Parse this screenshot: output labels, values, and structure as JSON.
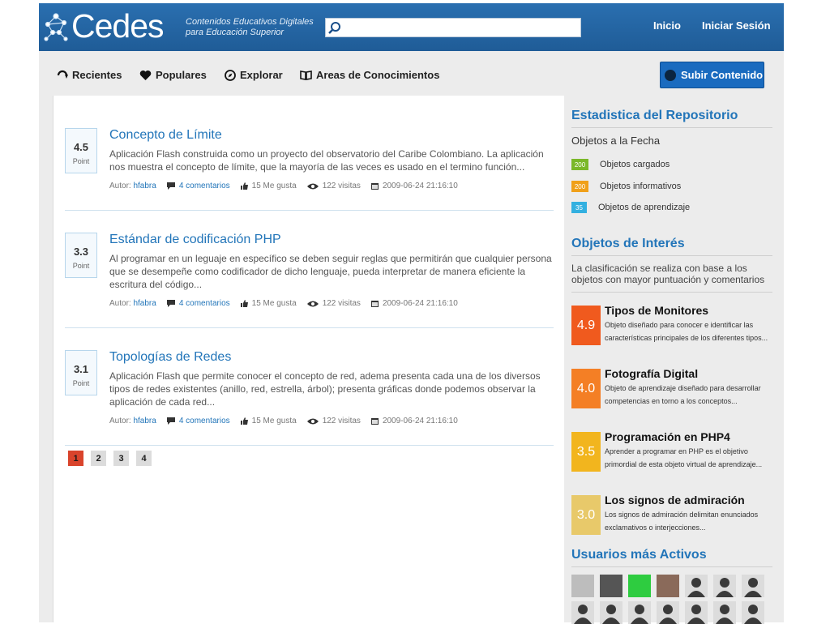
{
  "header": {
    "logo_text": "Cedes",
    "tagline_1": "Contenidos Educativos Digitales",
    "tagline_2": "para Educación Superior",
    "search_value": "",
    "links": [
      "Inicio",
      "Iniciar Sesión"
    ]
  },
  "nav": {
    "items": [
      "Recientes",
      "Populares",
      "Explorar",
      "Areas de Conocimientos"
    ],
    "upload_label": "Subir Contenido"
  },
  "posts": [
    {
      "score": "4.5",
      "score_label": "Point",
      "title": "Concepto de Límite",
      "desc": "Aplicación Flash construida como un proyecto del observatorio del Caribe Colombiano. La aplicación nos muestra el concepto de límite, que la mayoría de las veces es usado en el termino función...",
      "author_label": "Autor:",
      "author": "hfabra",
      "comments": "4 comentarios",
      "likes": "15 Me gusta",
      "views": "122 visitas",
      "date": "2009-06-24 21:16:10"
    },
    {
      "score": "3.3",
      "score_label": "Point",
      "title": "Estándar de codificación PHP",
      "desc": "Al programar en un leguaje en específico se deben seguir reglas que permitirán que cualquier persona que se desempeñe como codificador de dicho lenguaje, pueda interpretar de manera eficiente la escritura del código...",
      "author_label": "Autor:",
      "author": "hfabra",
      "comments": "4 comentarios",
      "likes": "15 Me gusta",
      "views": "122 visitas",
      "date": "2009-06-24 21:16:10"
    },
    {
      "score": "3.1",
      "score_label": "Point",
      "title": "Topologías de Redes",
      "desc": "Aplicación Flash que permite conocer el concepto de red, adema presenta cada una de los diversos tipos de redes existentes (anillo, red, estrella, árbol); presenta gráficas donde podemos observar la aplicación de cada red...",
      "author_label": "Autor:",
      "author": "hfabra",
      "comments": "4 comentarios",
      "likes": "15 Me gusta",
      "views": "122 visitas",
      "date": "2009-06-24 21:16:10"
    }
  ],
  "pagination": {
    "pages": [
      "1",
      "2",
      "3",
      "4"
    ],
    "current": "1"
  },
  "sidebar": {
    "stats_title": "Estadistica del Repositorio",
    "stats_subtitle": "Objetos a la Fecha",
    "stats": [
      {
        "count": "200",
        "label": "Objetos cargados",
        "color": "#7ab829"
      },
      {
        "count": "200",
        "label": "Objetos informativos",
        "color": "#f0a019"
      },
      {
        "count": "35",
        "label": "Objetos de aprendizaje",
        "color": "#33b0e0"
      }
    ],
    "interest_title": "Objetos de Interés",
    "interest_desc": "La clasificación se realiza con base a los objetos con mayor puntuación y comentarios",
    "interest": [
      {
        "score": "4.9",
        "title": "Tipos de Monitores",
        "desc": "Objeto diseñado para conocer e identificar las características principales de los diferentes tipos...",
        "color": "#f05a1e"
      },
      {
        "score": "4.0",
        "title": "Fotografía Digital",
        "desc": "Objeto de aprendizaje diseñado para desarrollar competencias en torno a los conceptos...",
        "color": "#f47f25"
      },
      {
        "score": "3.5",
        "title": "Programación en PHP4",
        "desc": "Aprender a programar en PHP es el objetivo primordial de esta objeto virtual de aprendizaje...",
        "color": "#f2b51e"
      },
      {
        "score": "3.0",
        "title": "Los signos de admiración",
        "desc": "Los signos de admiración delimitan enunciados exclamativos o interjecciones...",
        "color": "#e8c96a"
      }
    ],
    "users_title": "Usuarios más Activos"
  }
}
